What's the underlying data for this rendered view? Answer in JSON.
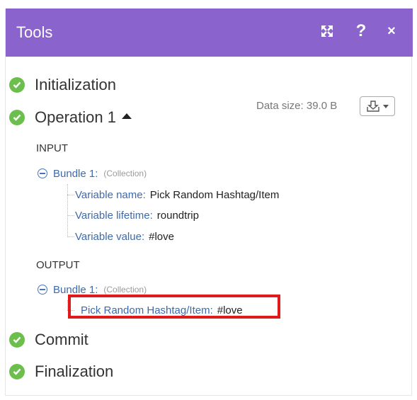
{
  "header": {
    "title": "Tools",
    "expand_icon": "expand-arrows-icon",
    "help_label": "?",
    "close_label": "×",
    "background": "#8a63cc"
  },
  "steps": {
    "initialization": "Initialization",
    "operation": "Operation 1",
    "commit": "Commit",
    "finalization": "Finalization"
  },
  "operation": {
    "data_size": "Data size: 39.0 B",
    "download_icon": "download-tray-icon"
  },
  "input": {
    "label": "INPUT",
    "bundle": {
      "name": "Bundle 1:",
      "type": "(Collection)",
      "fields": [
        {
          "key": "Variable name:",
          "value": "Pick Random Hashtag/Item"
        },
        {
          "key": "Variable lifetime:",
          "value": "roundtrip"
        },
        {
          "key": "Variable value:",
          "value": "#love"
        }
      ]
    }
  },
  "output": {
    "label": "OUTPUT",
    "bundle": {
      "name": "Bundle 1:",
      "type": "(Collection)",
      "fields": [
        {
          "key": "Pick Random Hashtag/Item:",
          "value": "#love"
        }
      ]
    }
  },
  "colors": {
    "success": "#6cbf4c",
    "key_text": "#3e6aab",
    "highlight": "#e01a1a"
  }
}
